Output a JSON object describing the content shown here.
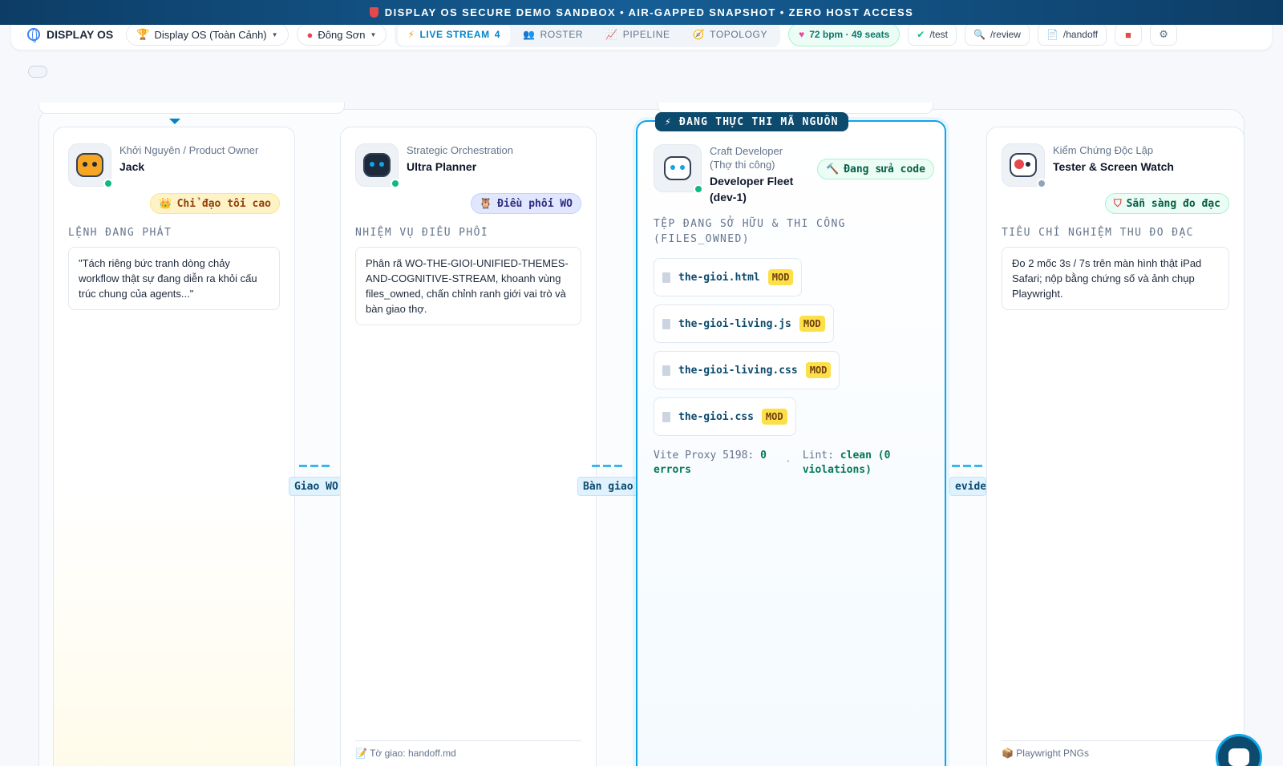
{
  "banner": {
    "text": "DISPLAY OS SECURE DEMO SANDBOX • AIR-GAPPED SNAPSHOT • ZERO HOST ACCESS"
  },
  "nav": {
    "brand": "DISPLAY OS",
    "workspace": "Display OS (Toàn Cảnh)",
    "theme": "Đông Sơn",
    "tabs": [
      {
        "label": "LIVE STREAM",
        "count": "4",
        "icon": "bolt-icon"
      },
      {
        "label": "ROSTER",
        "icon": "people-icon"
      },
      {
        "label": "PIPELINE",
        "icon": "chart-icon"
      },
      {
        "label": "TOPOLOGY",
        "icon": "compass-icon"
      }
    ],
    "heartbeat": "72 bpm · 49 seats",
    "commands": [
      "/test",
      "/review",
      "/handoff"
    ]
  },
  "colors": {
    "accent": "#0284c7",
    "banner": "#0d3d66",
    "success": "#10b981",
    "mod": "#fde047"
  },
  "agents": [
    {
      "role": "Khởi Nguyên / Product Owner",
      "name": "Jack",
      "badge": "Chỉ đạo tối cao",
      "section": "LỆNH ĐANG PHÁT",
      "body": "\"Tách riêng bức tranh dòng chảy workflow thật sự đang diễn ra khỏi cấu trúc chung của agents...\""
    },
    {
      "role": "Strategic Orchestration",
      "name": "Ultra Planner",
      "badge": "Điều phối WO",
      "section": "NHIỆM VỤ ĐIỀU PHỐI",
      "body": "Phân rã WO-THE-GIOI-UNIFIED-THEMES-AND-COGNITIVE-STREAM, khoanh vùng files_owned, chấn chỉnh ranh giới vai trò và bàn giao thợ.",
      "footer": "Tờ giao: handoff.md"
    },
    {
      "exec_label": "⚡ ĐANG THỰC THI MÃ NGUỒN",
      "role": "Craft Developer (Thợ thi công)",
      "name": "Developer Fleet (dev-1)",
      "badge": "Đang sửa code",
      "section": "TỆP ĐANG SỞ HỮU & THI CÔNG (FILES_OWNED)",
      "files": [
        "the-gioi.html",
        "the-gioi-living.js",
        "the-gioi-living.css",
        "the-gioi.css"
      ],
      "mod_label": "MOD",
      "proxy_label": "Vite Proxy 5198:",
      "proxy_value": "0 errors",
      "lint_label": "Lint:",
      "lint_value": "clean (0 violations)"
    },
    {
      "role": "Kiểm Chứng Độc Lập",
      "name": "Tester & Screen Watch",
      "badge": "Sẵn sàng đo đạc",
      "section": "TIÊU CHÍ NGHIỆM THU ĐO ĐẠC",
      "body": "Đo 2 mốc 3s / 7s trên màn hình thật iPad Safari; nộp bằng chứng số và ảnh chụp Playwright.",
      "footer": "Playwright PNGs"
    }
  ],
  "connectors": [
    "Giao WO",
    "Bàn giao",
    "evidence"
  ]
}
